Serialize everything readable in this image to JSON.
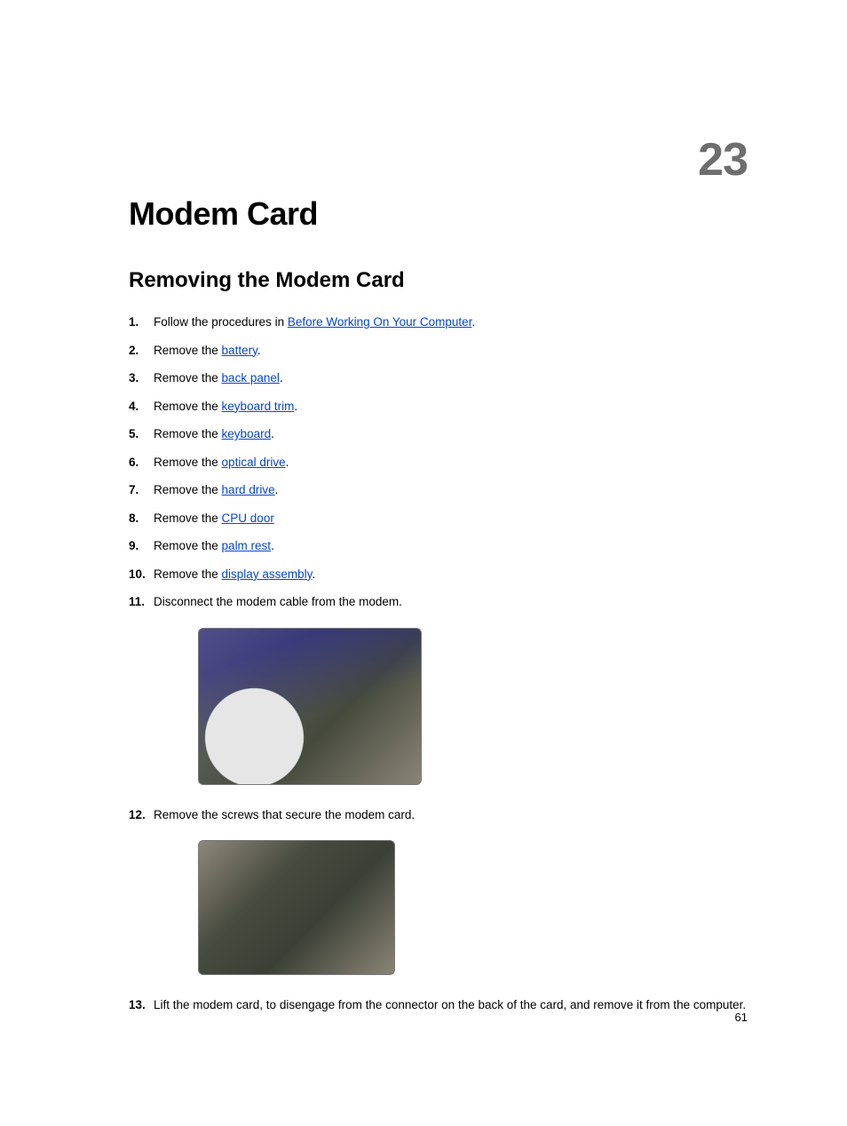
{
  "chapter_number": "23",
  "chapter_title": "Modem Card",
  "section_title": "Removing the Modem Card",
  "steps": [
    {
      "pre": "Follow the procedures in ",
      "link": "Before Working On Your Computer",
      "post": "."
    },
    {
      "pre": "Remove the ",
      "link": "battery",
      "post": "."
    },
    {
      "pre": "Remove the ",
      "link": "back panel",
      "post": "."
    },
    {
      "pre": "Remove the ",
      "link": "keyboard trim",
      "post": "."
    },
    {
      "pre": "Remove the ",
      "link": "keyboard",
      "post": "."
    },
    {
      "pre": "Remove the ",
      "link": "optical drive",
      "post": "."
    },
    {
      "pre": "Remove the ",
      "link": "hard drive",
      "post": "."
    },
    {
      "pre": "Remove the ",
      "link": "CPU door",
      "post": ""
    },
    {
      "pre": "Remove the ",
      "link": "palm rest",
      "post": "."
    },
    {
      "pre": "Remove the ",
      "link": "display assembly",
      "post": "."
    },
    {
      "pre": "Disconnect the modem cable from the modem.",
      "link": "",
      "post": ""
    },
    {
      "pre": "Remove the screws that secure the modem card.",
      "link": "",
      "post": ""
    },
    {
      "pre": "Lift the modem card, to disengage from the connector on the back of the card, and remove it from the computer.",
      "link": "",
      "post": ""
    }
  ],
  "page_number": "61"
}
